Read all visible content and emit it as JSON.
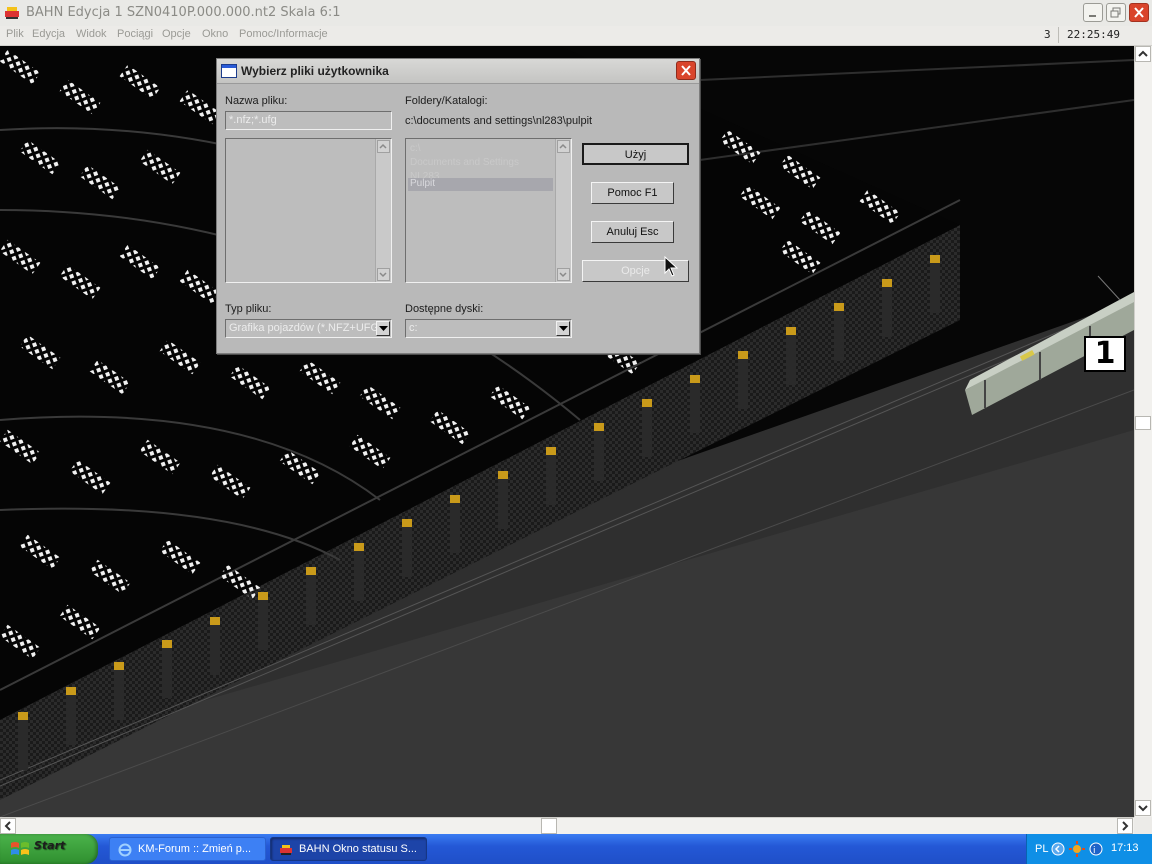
{
  "window": {
    "title": "BAHN Edycja 1 SZN0410P.000.000.nt2 Skala 6:1"
  },
  "menu": {
    "items": [
      "Plik",
      "Edycja",
      "Widok",
      "Pociągi",
      "Opcje",
      "Okno",
      "Pomoc/Informacje"
    ],
    "status_number": "3",
    "clock": "22:25:49"
  },
  "dialog": {
    "title": "Wybierz pliki użytkownika",
    "filename_label": "Nazwa pliku:",
    "filename_value": "*.nfz;*.ufg",
    "folders_label": "Foldery/Katalogi:",
    "folder_path": "c:\\documents and settings\\nl283\\pulpit",
    "folder_items": [
      "c:\\",
      "Documents and Settings",
      "NL283",
      "Pulpit"
    ],
    "selected_folder": "Pulpit",
    "filetype_label": "Typ pliku:",
    "filetype_value": "Grafika pojazdów (*.NFZ+UFG)",
    "drives_label": "Dostępne dyski:",
    "drive_value": "c:",
    "buttons": {
      "use": "Użyj",
      "help": "Pomoc    F1",
      "cancel": "Anuluj   Esc",
      "options": "Opcje"
    }
  },
  "canvas": {
    "train_marker": "1",
    "signal_color": "#c99a1a"
  },
  "taskbar": {
    "start": "Start",
    "tasks": [
      {
        "label": "KM-Forum :: Zmień p...",
        "icon": "ie-icon"
      },
      {
        "label": "BAHN Okno statusu S...",
        "icon": "bahn-icon"
      }
    ],
    "language": "PL",
    "clock": "17:13"
  }
}
